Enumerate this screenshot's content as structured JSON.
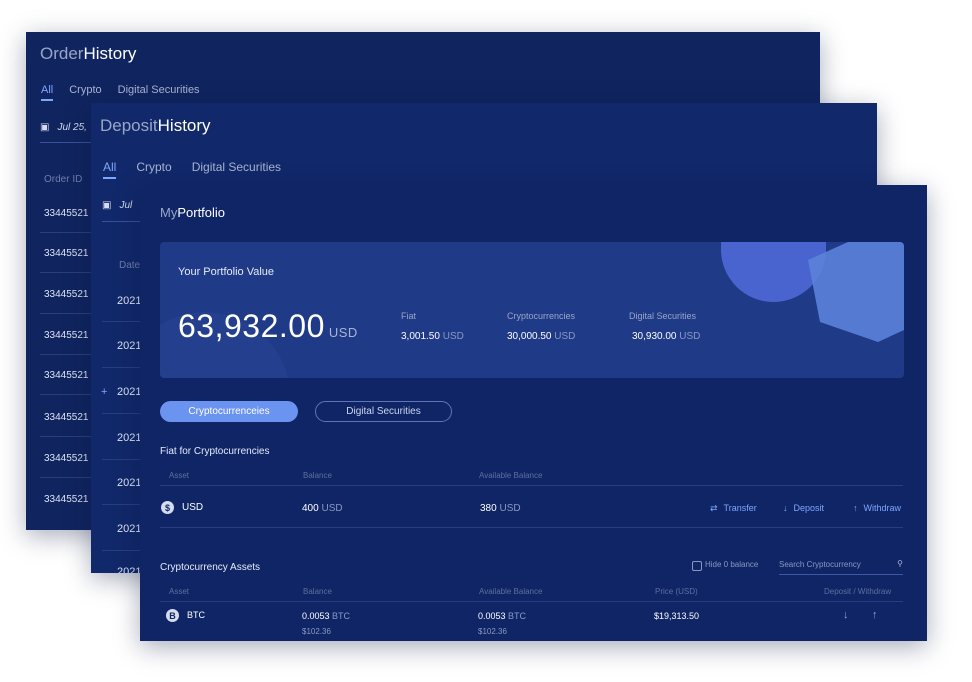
{
  "order_history": {
    "title_light": "Order",
    "title_bold": "History",
    "tabs": [
      "All",
      "Crypto",
      "Digital Securities"
    ],
    "date_partial": "Jul 25,",
    "col_order_id": "Order ID",
    "rows": [
      "33445521",
      "33445521",
      "33445521",
      "33445521",
      "33445521",
      "33445521",
      "33445521",
      "33445521"
    ]
  },
  "deposit_history": {
    "title_light": "Deposit",
    "title_bold": "History",
    "tabs": [
      "All",
      "Crypto",
      "Digital Securities"
    ],
    "date_partial": "Jul",
    "col_date": "Date",
    "plus": "+",
    "rows": [
      "2021",
      "2021",
      "2021",
      "2021",
      "2021",
      "2021",
      "2021"
    ]
  },
  "portfolio": {
    "title_light": "My",
    "title_bold": "Portfolio",
    "value_label": "Your Portfolio Value",
    "value_amount": "63,932.00",
    "value_unit": "USD",
    "stats": [
      {
        "label": "Fiat",
        "value": "3,001.50",
        "unit": "USD"
      },
      {
        "label": "Cryptocurrencies",
        "value": "30,000.50",
        "unit": "USD"
      },
      {
        "label": "Digital Securities",
        "value": "30,930.00",
        "unit": "USD"
      }
    ],
    "pill_active": "Cryptocurrenceies",
    "pill_other": "Digital Securities",
    "fiat_section": {
      "title": "Fiat for Cryptocurrencies",
      "headers": {
        "asset": "Asset",
        "balance": "Balance",
        "available": "Available Balance"
      },
      "row": {
        "icon": "$",
        "asset": "USD",
        "balance": "400",
        "balance_unit": "USD",
        "available": "380",
        "available_unit": "USD"
      },
      "actions": {
        "transfer": "Transfer",
        "deposit": "Deposit",
        "withdraw": "Withdraw"
      }
    },
    "crypto_section": {
      "title": "Cryptocurrency Assets",
      "hide_zero": "Hide 0 balance",
      "search_placeholder": "Search Cryptocurrency",
      "headers": {
        "asset": "Asset",
        "balance": "Balance",
        "available": "Available Balance",
        "price": "Price (USD)",
        "deposit_withdraw": "Deposit / Withdraw"
      },
      "row": {
        "icon": "B",
        "asset": "BTC",
        "balance": "0.0053",
        "balance_unit": "BTC",
        "balance_usd": "$102.36",
        "available": "0.0053",
        "available_unit": "BTC",
        "available_usd": "$102.36",
        "price": "$19,313.50"
      }
    }
  }
}
